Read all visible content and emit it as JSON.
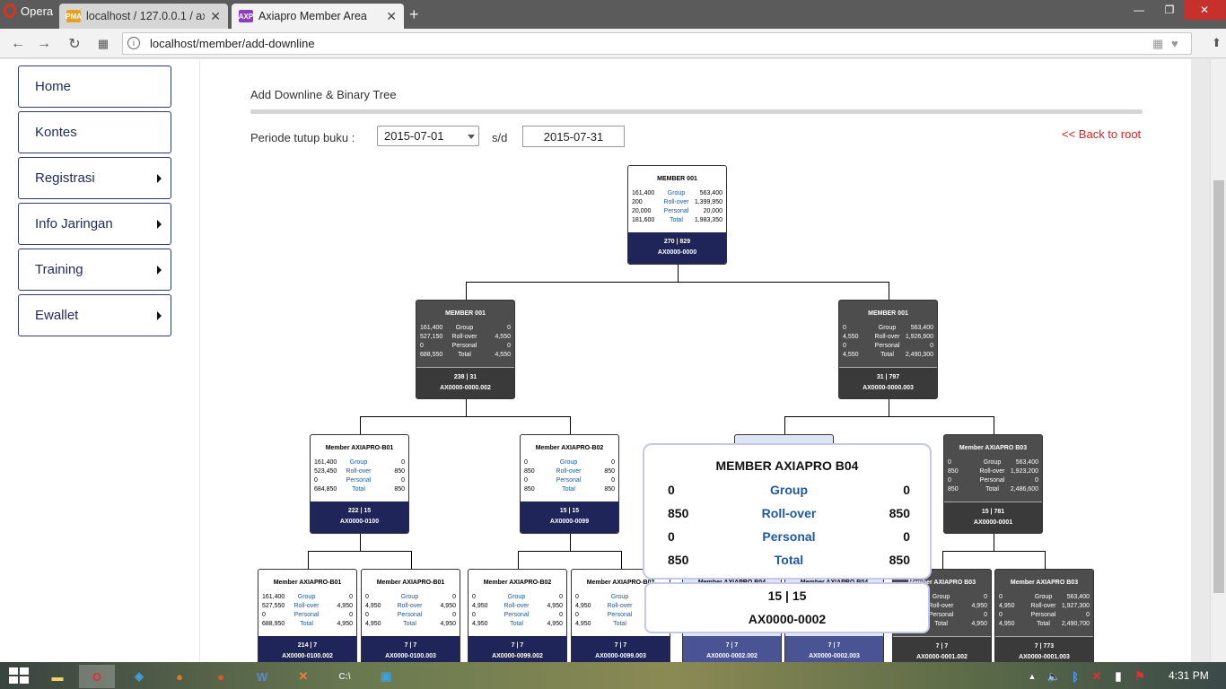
{
  "browser": {
    "app_name": "Opera",
    "tabs": [
      {
        "label": "localhost / 127.0.0.1 / axiap",
        "icon_text": "PMA"
      },
      {
        "label": "Axiapro Member Area",
        "icon_text": "AXP"
      }
    ],
    "url": "localhost/member/add-downline"
  },
  "sidebar": {
    "items": [
      {
        "label": "Home",
        "has_submenu": false
      },
      {
        "label": "Kontes",
        "has_submenu": false
      },
      {
        "label": "Registrasi",
        "has_submenu": true
      },
      {
        "label": "Info Jaringan",
        "has_submenu": true
      },
      {
        "label": "Training",
        "has_submenu": true
      },
      {
        "label": "Ewallet",
        "has_submenu": true
      }
    ]
  },
  "main": {
    "title": "Add Downline & Binary Tree",
    "period_label": "Periode tutup buku :",
    "period_start": "2015-07-01",
    "period_sep": "s/d",
    "period_end": "2015-07-31",
    "back_link": "<< Back to root"
  },
  "tree": {
    "nodes": [
      {
        "name": "MEMBER 001",
        "style": "white",
        "rows": [
          [
            "161,400",
            "Group",
            "563,400"
          ],
          [
            "200",
            "Roll-over",
            "1,399,950"
          ],
          [
            "20,000",
            "Personal",
            "20,000"
          ],
          [
            "181,600",
            "Total",
            "1,983,350"
          ]
        ],
        "count": "270 | 829",
        "code": "AX0000-0000"
      },
      {
        "name": "MEMBER 001",
        "style": "dark",
        "rows": [
          [
            "161,400",
            "Group",
            "0"
          ],
          [
            "527,150",
            "Roll-over",
            "4,550"
          ],
          [
            "0",
            "Personal",
            "0"
          ],
          [
            "688,550",
            "Total",
            "4,550"
          ]
        ],
        "count": "238 | 31",
        "code": "AX0000-0000.002"
      },
      {
        "name": "MEMBER 001",
        "style": "dark",
        "rows": [
          [
            "0",
            "Group",
            "563,400"
          ],
          [
            "4,550",
            "Roll-over",
            "1,926,900"
          ],
          [
            "0",
            "Personal",
            "0"
          ],
          [
            "4,550",
            "Total",
            "2,490,300"
          ]
        ],
        "count": "31 | 797",
        "code": "AX0000-0000.003"
      },
      {
        "name": "Member AXIAPRO-B01",
        "style": "white",
        "rows": [
          [
            "161,400",
            "Group",
            "0"
          ],
          [
            "523,450",
            "Roll-over",
            "850"
          ],
          [
            "0",
            "Personal",
            "0"
          ],
          [
            "684,850",
            "Total",
            "850"
          ]
        ],
        "count": "222 | 15",
        "code": "AX0000-0100"
      },
      {
        "name": "Member AXIAPRO-B02",
        "style": "white",
        "rows": [
          [
            "0",
            "Group",
            "0"
          ],
          [
            "850",
            "Roll-over",
            "850"
          ],
          [
            "0",
            "Personal",
            "0"
          ],
          [
            "850",
            "Total",
            "850"
          ]
        ],
        "count": "15 | 15",
        "code": "AX0000-0099"
      },
      {
        "name": "Member AXIAPRO B04",
        "style": "light",
        "rows": [
          [
            "0",
            "Group",
            "0"
          ],
          [
            "850",
            "Roll-over",
            "850"
          ],
          [
            "0",
            "Personal",
            "0"
          ],
          [
            "850",
            "Total",
            "850"
          ]
        ],
        "count": "15 | 15",
        "code": "AX0000-0002"
      },
      {
        "name": "Member AXIAPRO B03",
        "style": "dark",
        "rows": [
          [
            "0",
            "Group",
            "563,400"
          ],
          [
            "850",
            "Roll-over",
            "1,923,200"
          ],
          [
            "0",
            "Personal",
            "0"
          ],
          [
            "850",
            "Total",
            "2,486,600"
          ]
        ],
        "count": "15 | 781",
        "code": "AX0000-0001"
      },
      {
        "name": "Member AXIAPRO-B01",
        "style": "white",
        "rows": [
          [
            "161,400",
            "Group",
            "0"
          ],
          [
            "527,550",
            "Roll-over",
            "4,950"
          ],
          [
            "0",
            "Personal",
            "0"
          ],
          [
            "688,950",
            "Total",
            "4,950"
          ]
        ],
        "count": "214 | 7",
        "code": "AX0000-0100.002"
      },
      {
        "name": "Member AXIAPRO-B01",
        "style": "white",
        "rows": [
          [
            "0",
            "Group",
            "0"
          ],
          [
            "4,950",
            "Roll-over",
            "4,950"
          ],
          [
            "0",
            "Personal",
            "0"
          ],
          [
            "4,950",
            "Total",
            "4,950"
          ]
        ],
        "count": "7 | 7",
        "code": "AX0000-0100.003"
      },
      {
        "name": "Member AXIAPRO-B02",
        "style": "white",
        "rows": [
          [
            "0",
            "Group",
            "0"
          ],
          [
            "4,950",
            "Roll-over",
            "4,950"
          ],
          [
            "0",
            "Personal",
            "0"
          ],
          [
            "4,950",
            "Total",
            "4,950"
          ]
        ],
        "count": "7 | 7",
        "code": "AX0000-0099.002"
      },
      {
        "name": "Member AXIAPRO-B02",
        "style": "white",
        "rows": [
          [
            "0",
            "Group",
            "0"
          ],
          [
            "4,950",
            "Roll-over",
            "4,950"
          ],
          [
            "0",
            "Personal",
            "0"
          ],
          [
            "4,950",
            "Total",
            "4,950"
          ]
        ],
        "count": "7 | 7",
        "code": "AX0000-0099.003"
      },
      {
        "name": "Member AXIAPRO B04",
        "style": "light",
        "rows": [],
        "count": "7 | 7",
        "code": "AX0000-0002.002"
      },
      {
        "name": "Member AXIAPRO B04",
        "style": "light",
        "rows": [],
        "count": "7 | 7",
        "code": "AX0000-0002.003"
      },
      {
        "name": "Member AXIAPRO B03",
        "style": "dark",
        "rows": [
          [
            "0",
            "Group",
            "0"
          ],
          [
            "4,950",
            "Roll-over",
            "4,950"
          ],
          [
            "0",
            "Personal",
            "0"
          ],
          [
            "4,950",
            "Total",
            "4,950"
          ]
        ],
        "count": "7 | 7",
        "code": "AX0000-0001.002"
      },
      {
        "name": "Member AXIAPRO B03",
        "style": "dark",
        "rows": [
          [
            "0",
            "Group",
            "563,400"
          ],
          [
            "4,950",
            "Roll-over",
            "1,927,300"
          ],
          [
            "0",
            "Personal",
            "0"
          ],
          [
            "4,950",
            "Total",
            "2,490,700"
          ]
        ],
        "count": "7 | 773",
        "code": "AX0000-0001.003"
      }
    ]
  },
  "popup": {
    "title": "MEMBER AXIAPRO B04",
    "rows": [
      [
        "0",
        "Group",
        "0"
      ],
      [
        "850",
        "Roll-over",
        "850"
      ],
      [
        "0",
        "Personal",
        "0"
      ],
      [
        "850",
        "Total",
        "850"
      ]
    ],
    "count": "15 | 15",
    "code": "AX0000-0002"
  },
  "taskbar": {
    "clock": "4:31 PM"
  },
  "colors": {
    "navy_footer": "#1f2558",
    "dark_node": "#4d4d4d",
    "light_node_footer": "#4a5494",
    "label_blue": "#1e5aa0",
    "back_link": "#e02020"
  }
}
